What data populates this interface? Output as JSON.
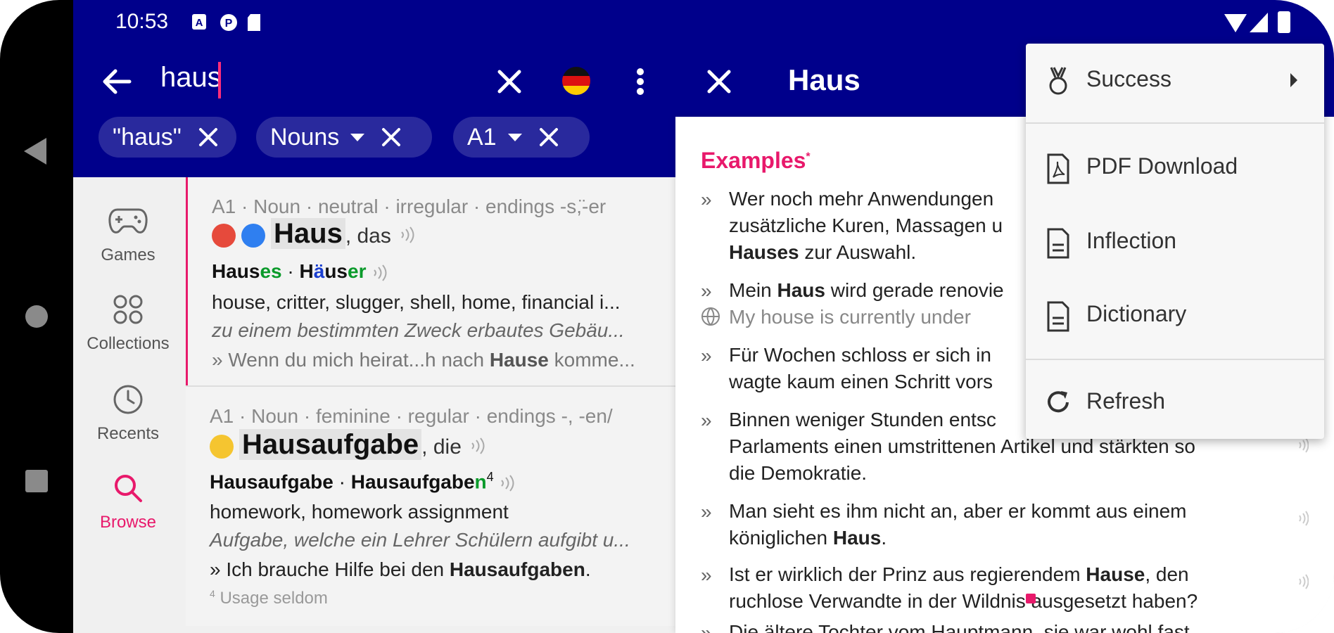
{
  "status": {
    "time": "10:53"
  },
  "search": {
    "query": "haus"
  },
  "chips": [
    {
      "label": "\"haus\""
    },
    {
      "label": "Nouns"
    },
    {
      "label": "A1"
    }
  ],
  "detail": {
    "title": "Haus",
    "examples_title": "Examples",
    "examples_marker": "*",
    "lines": {
      "l1": "Wer noch mehr Anwendungen",
      "l2": "zusätzliche Kuren, Massagen u",
      "l3a": "Hauses",
      "l3b": " zur Auswahl.",
      "l4a": "Mein ",
      "l4b": "Haus",
      "l4c": " wird gerade renovie",
      "l5": "My house is currently under",
      "l6": "Für Wochen schloss er sich in",
      "l7": "wagte kaum einen Schritt vors",
      "l8": "Binnen weniger Stunden entsc",
      "l9": "Parlaments einen umstrittenen Artikel und stärkten so",
      "l10": "die Demokratie.",
      "l11": "Man sieht es ihm nicht an, aber er kommt aus einem",
      "l12a": "königlichen ",
      "l12b": "Haus",
      "l12c": ".",
      "l13a": "Ist er wirklich der Prinz aus regierendem ",
      "l13b": "Hause",
      "l13c": ", den",
      "l14": "ruchlose Verwandte in der Wildnis ausgesetzt haben?",
      "l15": "Die ältere Tochter vom Hauptmann, sie war wohl fast"
    }
  },
  "rail": [
    {
      "label": "Games"
    },
    {
      "label": "Collections"
    },
    {
      "label": "Recents"
    },
    {
      "label": "Browse"
    }
  ],
  "entries": [
    {
      "meta": "A1 · Noun · neutral · irregular · endings -s,̈-er",
      "word": "Haus",
      "article": ", das",
      "forms": {
        "a": "Haus",
        "a_end": "es",
        "sep": " · ",
        "b1": "H",
        "b2": "ä",
        "b3": "us",
        "b_end": "er"
      },
      "translation": "house, critter, slugger, shell, home, financial i...",
      "definition": "zu einem bestimmten Zweck erbautes Gebäu...",
      "example_pre": "» Wenn du mich heirat...h nach ",
      "example_bold": "Hause",
      "example_post": " komme...",
      "colors": [
        "#e64a3c",
        "#2f7ff0"
      ]
    },
    {
      "meta": "A1 · Noun · feminine · regular · endings -, -en/",
      "word": "Hausaufgabe",
      "article": ", die",
      "forms": {
        "a": "Hausaufgabe",
        "sep": " · ",
        "b": "Hausaufgabe",
        "b_end": "n",
        "sup": "4"
      },
      "translation": "homework, homework assignment",
      "definition": "Aufgabe, welche ein Lehrer Schülern aufgibt u...",
      "example_pre": "» Ich brauche Hilfe bei den ",
      "example_bold": "Hausaufgaben",
      "example_post": ".",
      "footnote_sup": "4",
      "footnote": " Usage seldom",
      "colors": [
        "#f5c530"
      ]
    }
  ],
  "menu": {
    "items": [
      {
        "label": "Success"
      },
      {
        "label": "PDF Download"
      },
      {
        "label": "Inflection"
      },
      {
        "label": "Dictionary"
      },
      {
        "label": "Refresh"
      }
    ]
  }
}
